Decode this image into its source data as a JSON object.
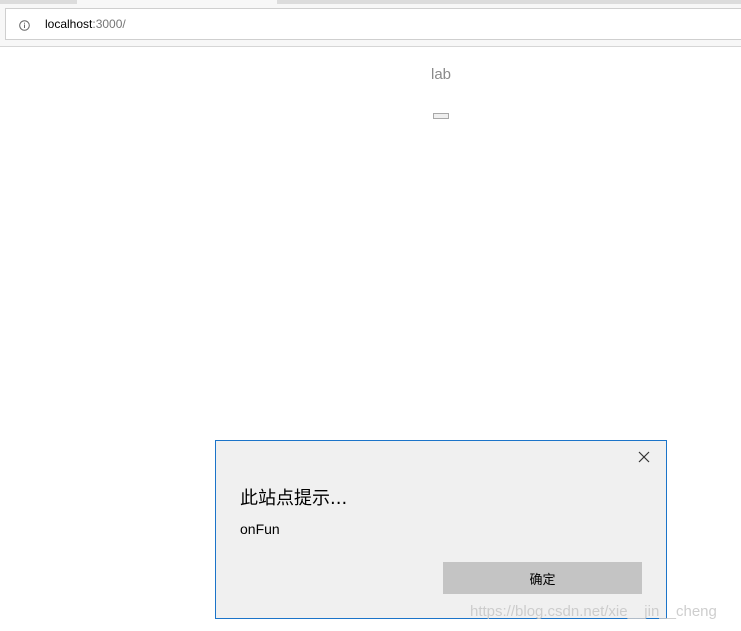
{
  "browser": {
    "url_host": "localhost",
    "url_rest": ":3000/"
  },
  "page": {
    "lab_text": "lab",
    "button_label": ""
  },
  "dialog": {
    "title": "此站点提示...",
    "message": "onFun",
    "ok_label": "确定"
  },
  "watermark": "https://blog.csdn.net/xie__jin__cheng",
  "colors": {
    "dialog_border": "#1b74c9",
    "dialog_background": "#f0f0f0",
    "ok_button": "#c4c4c4"
  },
  "icons": {
    "address_info": "info-icon",
    "dialog_close": "close-icon"
  }
}
